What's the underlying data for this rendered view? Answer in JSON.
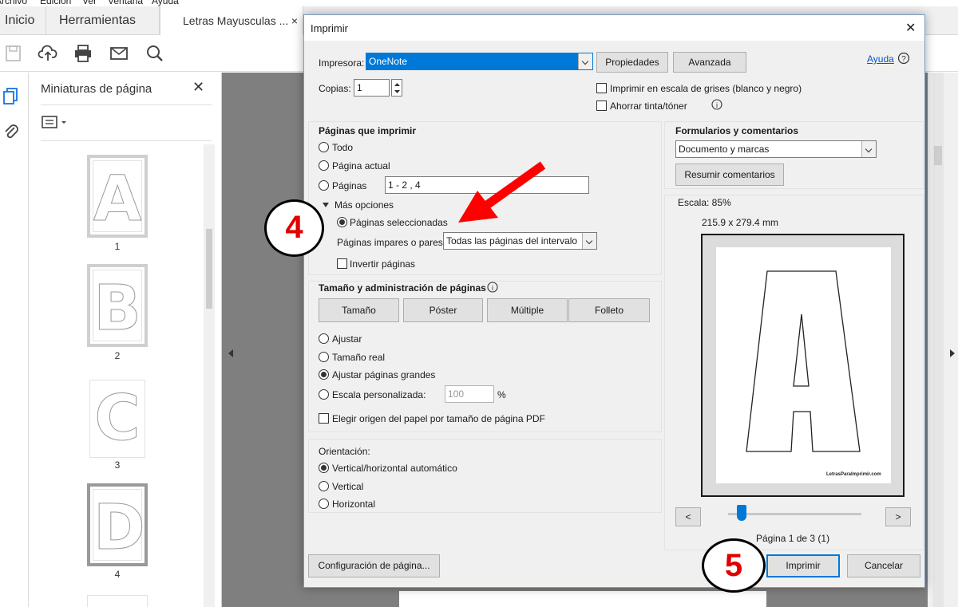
{
  "app": {
    "menu": [
      "Archivo",
      "Edición",
      "Ver",
      "Ventana",
      "Ayuda"
    ],
    "tabs": [
      {
        "label": "Inicio"
      },
      {
        "label": "Herramientas"
      },
      {
        "label": "Letras Mayusculas ..."
      }
    ],
    "tab_close": "×",
    "thumbnails": {
      "title": "Miniaturas de página",
      "close": "✕",
      "pages": [
        {
          "letter": "A",
          "number": "1"
        },
        {
          "letter": "B",
          "number": "2"
        },
        {
          "letter": "C",
          "number": "3"
        },
        {
          "letter": "D",
          "number": "4"
        }
      ]
    }
  },
  "dialog": {
    "title": "Imprimir",
    "close": "✕",
    "printer_label": "Impresora:",
    "printer_value": "OneNote",
    "properties_button": "Propiedades",
    "advanced_button": "Avanzada",
    "help_link": "Ayuda",
    "copies_label": "Copias:",
    "copies_value": "1",
    "grayscale_label": "Imprimir en escala de grises (blanco y negro)",
    "save_ink_label": "Ahorrar tinta/tóner",
    "pages_section": {
      "title": "Páginas que imprimir",
      "all": "Todo",
      "current": "Página actual",
      "pages": "Páginas",
      "pages_value": "1 - 2 , 4",
      "more_options": "Más opciones",
      "selected_pages": "Páginas seleccionadas",
      "odd_even_label": "Páginas impares o pares",
      "odd_even_value": "Todas las páginas del intervalo",
      "reverse": "Invertir páginas"
    },
    "size_section": {
      "title": "Tamaño y administración de páginas",
      "tabs": [
        "Tamaño",
        "Póster",
        "Múltiple",
        "Folleto"
      ],
      "fit": "Ajustar",
      "actual": "Tamaño real",
      "shrink": "Ajustar páginas grandes",
      "custom": "Escala personalizada:",
      "custom_value": "100",
      "percent": "%",
      "choose_source": "Elegir origen del papel por tamaño de página PDF"
    },
    "orientation_section": {
      "title": "Orientación:",
      "auto": "Vertical/horizontal automático",
      "portrait": "Vertical",
      "landscape": "Horizontal"
    },
    "comments_section": {
      "title": "Formularios y comentarios",
      "value": "Documento y marcas",
      "summarize_button": "Resumir comentarios"
    },
    "preview": {
      "scale": "Escala:  85%",
      "dimensions": "215.9 x 279.4 mm",
      "watermark": "LetrasParaImprimir.com",
      "prev": "<",
      "next": ">",
      "page_info": "Página 1 de 3 (1)",
      "slider_fraction": 0.1
    },
    "page_setup_button": "Configuración de página...",
    "print_button": "Imprimir",
    "cancel_button": "Cancelar"
  },
  "annotations": {
    "step4": "4",
    "step5": "5"
  },
  "colors": {
    "accent": "#0078d7",
    "arrow": "#ff0000",
    "badge_text": "#e00000"
  }
}
